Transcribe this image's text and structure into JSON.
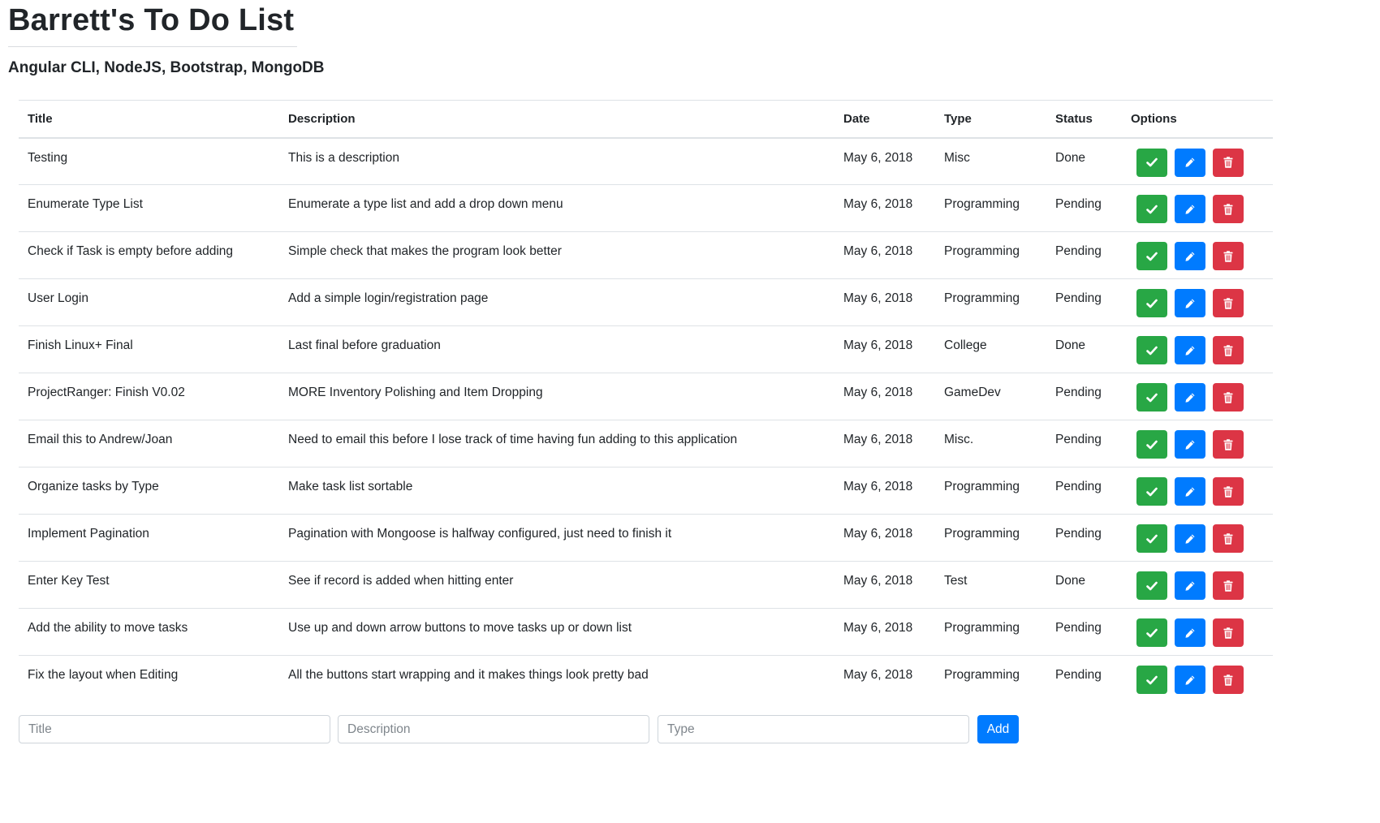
{
  "header": {
    "title": "Barrett's To Do List",
    "subtitle": "Angular CLI, NodeJS, Bootstrap, MongoDB"
  },
  "table": {
    "columns": [
      "Title",
      "Description",
      "Date",
      "Type",
      "Status",
      "Options"
    ],
    "rows": [
      {
        "title": "Testing",
        "description": "This is a description",
        "date": "May 6, 2018",
        "type": "Misc",
        "status": "Done"
      },
      {
        "title": "Enumerate Type List",
        "description": "Enumerate a type list and add a drop down menu",
        "date": "May 6, 2018",
        "type": "Programming",
        "status": "Pending"
      },
      {
        "title": "Check if Task is empty before adding",
        "description": "Simple check that makes the program look better",
        "date": "May 6, 2018",
        "type": "Programming",
        "status": "Pending"
      },
      {
        "title": "User Login",
        "description": "Add a simple login/registration page",
        "date": "May 6, 2018",
        "type": "Programming",
        "status": "Pending"
      },
      {
        "title": "Finish Linux+ Final",
        "description": "Last final before graduation",
        "date": "May 6, 2018",
        "type": "College",
        "status": "Done"
      },
      {
        "title": "ProjectRanger: Finish V0.02",
        "description": "MORE Inventory Polishing and Item Dropping",
        "date": "May 6, 2018",
        "type": "GameDev",
        "status": "Pending"
      },
      {
        "title": "Email this to Andrew/Joan",
        "description": "Need to email this before I lose track of time having fun adding to this application",
        "date": "May 6, 2018",
        "type": "Misc.",
        "status": "Pending"
      },
      {
        "title": "Organize tasks by Type",
        "description": "Make task list sortable",
        "date": "May 6, 2018",
        "type": "Programming",
        "status": "Pending"
      },
      {
        "title": "Implement Pagination",
        "description": "Pagination with Mongoose is halfway configured, just need to finish it",
        "date": "May 6, 2018",
        "type": "Programming",
        "status": "Pending"
      },
      {
        "title": "Enter Key Test",
        "description": "See if record is added when hitting enter",
        "date": "May 6, 2018",
        "type": "Test",
        "status": "Done"
      },
      {
        "title": "Add the ability to move tasks",
        "description": "Use up and down arrow buttons to move tasks up or down list",
        "date": "May 6, 2018",
        "type": "Programming",
        "status": "Pending"
      },
      {
        "title": "Fix the layout when Editing",
        "description": "All the buttons start wrapping and it makes things look pretty bad",
        "date": "May 6, 2018",
        "type": "Programming",
        "status": "Pending"
      }
    ],
    "row_actions": [
      {
        "name": "done",
        "icon": "check-icon"
      },
      {
        "name": "edit",
        "icon": "pencil-icon"
      },
      {
        "name": "delete",
        "icon": "trash-icon"
      }
    ]
  },
  "add_form": {
    "title_value": "",
    "title_placeholder": "Title",
    "description_value": "",
    "description_placeholder": "Description",
    "type_value": "",
    "type_placeholder": "Type",
    "add_label": "Add"
  },
  "colors": {
    "success": "#28a745",
    "primary": "#007bff",
    "danger": "#dc3545",
    "border": "#dee2e6",
    "text": "#212529"
  }
}
